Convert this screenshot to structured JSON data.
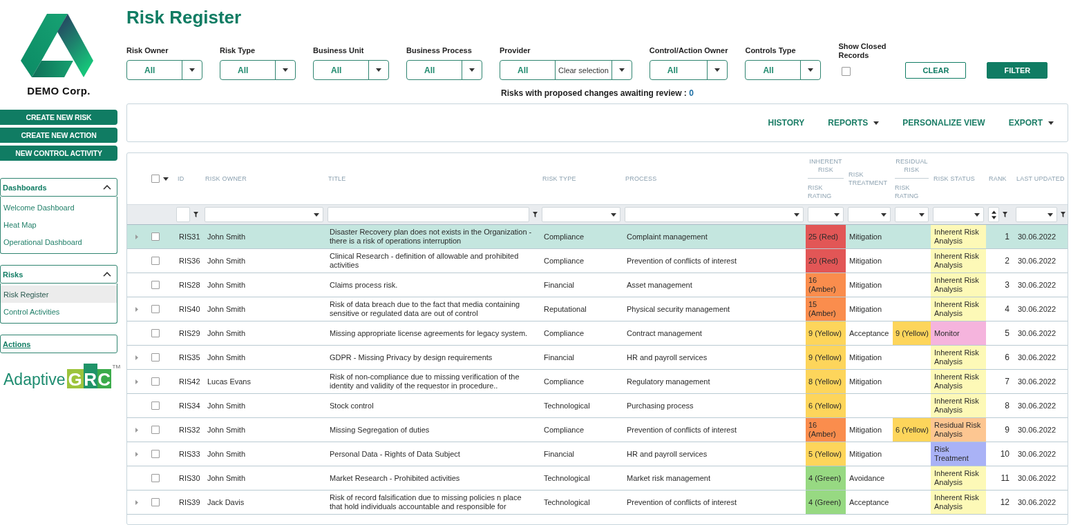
{
  "sidebar": {
    "company": "DEMO Corp.",
    "buttons": [
      "CREATE NEW RISK",
      "CREATE NEW ACTION",
      "NEW CONTROL ACTIVITY"
    ],
    "sections": [
      {
        "kind": "group",
        "title": "Dashboards",
        "expanded": true,
        "items": [
          {
            "label": "Welcome Dashboard",
            "selected": false
          },
          {
            "label": "Heat Map",
            "selected": false
          },
          {
            "label": "Operational Dashboard",
            "selected": false
          }
        ]
      },
      {
        "kind": "group",
        "title": "Risks",
        "expanded": true,
        "items": [
          {
            "label": "Risk Register",
            "selected": true
          },
          {
            "label": "Control Activities",
            "selected": false
          }
        ]
      },
      {
        "kind": "link",
        "title": "Actions"
      }
    ],
    "brand": {
      "name": "Adaptive",
      "mark": "GRC",
      "tm": "TM"
    }
  },
  "page_title": "Risk Register",
  "filters": [
    {
      "label": "Risk Owner",
      "value": "All"
    },
    {
      "label": "Risk Type",
      "value": "All"
    },
    {
      "label": "Business Unit",
      "value": "All"
    },
    {
      "label": "Business Process",
      "value": "All"
    },
    {
      "label": "Provider",
      "value": "All",
      "clear": "Clear selection"
    },
    {
      "label": "Control/Action Owner",
      "value": "All"
    },
    {
      "label": "Controls Type",
      "value": "All"
    }
  ],
  "show_closed": {
    "label": "Show Closed Records",
    "checked": false
  },
  "actions": [
    {
      "label": "CLEAR",
      "kind": "secondary"
    },
    {
      "label": "FILTER",
      "kind": "primary"
    }
  ],
  "review_notice": {
    "text": "Risks with proposed changes awaiting review :",
    "count": "0"
  },
  "toolbar": [
    {
      "label": "HISTORY",
      "dropdown": false
    },
    {
      "label": "REPORTS",
      "dropdown": true
    },
    {
      "label": "PERSONALIZE VIEW",
      "dropdown": false
    },
    {
      "label": "EXPORT",
      "dropdown": true
    }
  ],
  "table": {
    "select_all": {
      "checked": false
    },
    "columns": [
      {
        "label": "ID",
        "kind": "text",
        "funnel": true
      },
      {
        "label": "RISK OWNER",
        "kind": "select",
        "funnel": false
      },
      {
        "label": "TITLE",
        "kind": "text",
        "funnel": true
      },
      {
        "label": "RISK TYPE",
        "kind": "select",
        "funnel": false
      },
      {
        "label": "PROCESS",
        "kind": "select",
        "funnel": false
      },
      {
        "group": "INHERENT RISK",
        "label": "RISK RATING",
        "kind": "select",
        "funnel": false
      },
      {
        "label": "RISK TREATMENT",
        "kind": "select",
        "funnel": false
      },
      {
        "group": "RESIDUAL RISK",
        "label": "RISK RATING",
        "kind": "select",
        "funnel": false
      },
      {
        "label": "RISK STATUS",
        "kind": "select",
        "funnel": false
      },
      {
        "label": "RANK",
        "kind": "sort",
        "funnel": true
      },
      {
        "label": "LAST UPDATED",
        "kind": "select",
        "funnel": true
      }
    ],
    "rows": [
      {
        "id": "RIS31",
        "owner": "John Smith",
        "title": "Disaster Recovery plan does not exists in the Organization - there is a risk of operations interruption",
        "type": "Compliance",
        "process": "Complaint management",
        "inherent": {
          "text": "25 (Red)",
          "color": "#e25656"
        },
        "treatment": "Mitigation",
        "status": {
          "text": "Inherent Risk Analysis",
          "color": "#fdf9b7"
        },
        "rank": "1",
        "updated": "30.06.2022",
        "expandable": true,
        "checked": false,
        "selected": true
      },
      {
        "id": "RIS36",
        "owner": "John Smith",
        "title": "Clinical Research - definition of allowable and prohibited activities",
        "type": "Compliance",
        "process": "Prevention of conflicts of interest",
        "inherent": {
          "text": "20 (Red)",
          "color": "#e25656"
        },
        "treatment": "Mitigation",
        "status": {
          "text": "Inherent Risk Analysis",
          "color": "#fdf9b7"
        },
        "rank": "2",
        "updated": "30.06.2022",
        "expandable": false,
        "checked": false,
        "selected": false
      },
      {
        "id": "RIS28",
        "owner": "John Smith",
        "title": "Claims process risk.",
        "type": "Financial",
        "process": "Asset management",
        "inherent": {
          "text": "16 (Amber)",
          "color": "#fa8d4d"
        },
        "treatment": "Mitigation",
        "status": {
          "text": "Inherent Risk Analysis",
          "color": "#fdf9b7"
        },
        "rank": "3",
        "updated": "30.06.2022",
        "expandable": false,
        "checked": false,
        "selected": false
      },
      {
        "id": "RIS40",
        "owner": "John Smith",
        "title": "Risk of data breach due to the fact that media containing sensitive or regulated data are out of control",
        "type": "Reputational",
        "process": "Physical security management",
        "inherent": {
          "text": "15 (Amber)",
          "color": "#fa8d4d"
        },
        "treatment": "Mitigation",
        "status": {
          "text": "Inherent Risk Analysis",
          "color": "#fdf9b7"
        },
        "rank": "4",
        "updated": "30.06.2022",
        "expandable": true,
        "checked": false,
        "selected": false
      },
      {
        "id": "RIS29",
        "owner": "John Smith",
        "title": "Missing appropriate license agreements for legacy system.",
        "type": "Compliance",
        "process": "Contract management",
        "inherent": {
          "text": "9 (Yellow)",
          "color": "#fdd55b"
        },
        "treatment": "Acceptance",
        "residual": {
          "text": "9 (Yellow)",
          "color": "#fdd55b"
        },
        "status": {
          "text": "Monitor",
          "color": "#f5b4dd"
        },
        "rank": "5",
        "updated": "30.06.2022",
        "expandable": false,
        "checked": false,
        "selected": false
      },
      {
        "id": "RIS35",
        "owner": "John Smith",
        "title": "GDPR - Missing Privacy by design requirements",
        "type": "Financial",
        "process": "HR and payroll services",
        "inherent": {
          "text": "9 (Yellow)",
          "color": "#fdd55b"
        },
        "treatment": "Mitigation",
        "status": {
          "text": "Inherent Risk Analysis",
          "color": "#fdf9b7"
        },
        "rank": "6",
        "updated": "30.06.2022",
        "expandable": true,
        "checked": false,
        "selected": false
      },
      {
        "id": "RIS42",
        "owner": "Lucas Evans",
        "title": "Risk of non-compliance due to missing verification of the identity and validity of the requestor in procedure..",
        "type": "Compliance",
        "process": "Regulatory management",
        "inherent": {
          "text": "8 (Yellow)",
          "color": "#fdd55b"
        },
        "treatment": "Mitigation",
        "status": {
          "text": "Inherent Risk Analysis",
          "color": "#fdf9b7"
        },
        "rank": "7",
        "updated": "30.06.2022",
        "expandable": true,
        "checked": false,
        "selected": false
      },
      {
        "id": "RIS34",
        "owner": "John Smith",
        "title": "Stock control",
        "type": "Technological",
        "process": "Purchasing process",
        "inherent": {
          "text": "6 (Yellow)",
          "color": "#fdd55b"
        },
        "status": {
          "text": "Inherent Risk Analysis",
          "color": "#fdf9b7"
        },
        "rank": "8",
        "updated": "30.06.2022",
        "expandable": false,
        "checked": false,
        "selected": false
      },
      {
        "id": "RIS32",
        "owner": "John Smith",
        "title": "Missing Segregation of duties",
        "type": "Compliance",
        "process": "Prevention of conflicts of interest",
        "inherent": {
          "text": "16 (Amber)",
          "color": "#fa8d4d"
        },
        "treatment": "Mitigation",
        "residual": {
          "text": "6 (Yellow)",
          "color": "#fdd55b"
        },
        "status": {
          "text": "Residual Risk Analysis",
          "color": "#fdc691"
        },
        "rank": "9",
        "updated": "30.06.2022",
        "expandable": true,
        "checked": false,
        "selected": false
      },
      {
        "id": "RIS33",
        "owner": "John Smith",
        "title": "Personal Data - Rights of Data Subject",
        "type": "Financial",
        "process": "HR and payroll services",
        "inherent": {
          "text": "5 (Yellow)",
          "color": "#fdd55b"
        },
        "treatment": "Mitigation",
        "status": {
          "text": "Risk Treatment",
          "color": "#a9b2f6"
        },
        "rank": "10",
        "updated": "30.06.2022",
        "expandable": true,
        "checked": false,
        "selected": false
      },
      {
        "id": "RIS30",
        "owner": "John Smith",
        "title": "Market Research - Prohibited activities",
        "type": "Technological",
        "process": "Market risk management",
        "inherent": {
          "text": "4 (Green)",
          "color": "#97d982"
        },
        "treatment": "Avoidance",
        "status": {
          "text": "Inherent Risk Analysis",
          "color": "#fdf9b7"
        },
        "rank": "11",
        "updated": "30.06.2022",
        "expandable": false,
        "checked": false,
        "selected": false
      },
      {
        "id": "RIS39",
        "owner": "Jack Davis",
        "title": "Risk of record falsification due to missing policies n place that hold individuals accountable and responsible for",
        "type": "Technological",
        "process": "Prevention of conflicts of interest",
        "inherent": {
          "text": "4 (Green)",
          "color": "#97d982"
        },
        "treatment": "Acceptance",
        "status": {
          "text": "Inherent Risk Analysis",
          "color": "#fdf9b7"
        },
        "rank": "12",
        "updated": "30.06.2022",
        "expandable": true,
        "checked": false,
        "selected": false
      }
    ]
  }
}
